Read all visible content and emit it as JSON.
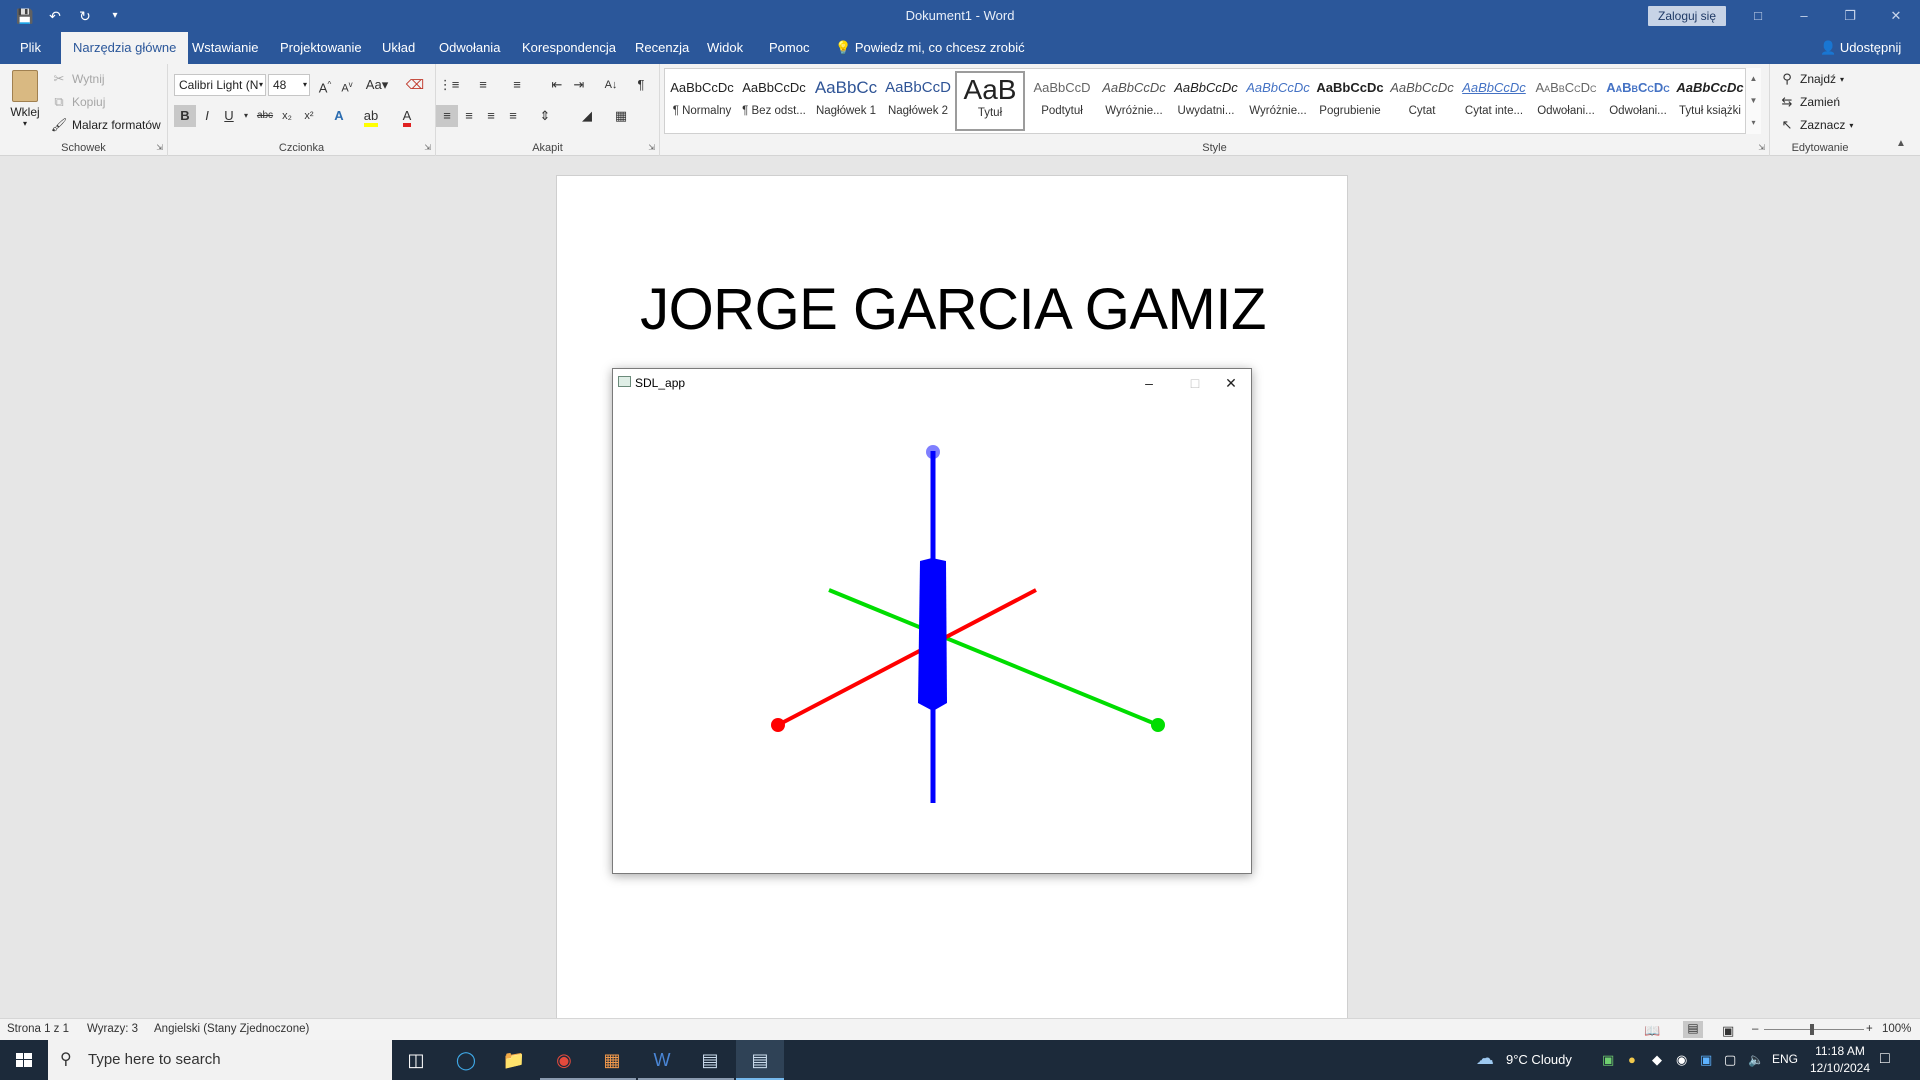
{
  "window": {
    "title": "Dokument1 - Word",
    "signin_label": "Zaloguj się",
    "qat": {
      "save_icon": "save-icon",
      "undo_icon": "undo-icon",
      "redo_icon": "redo-icon",
      "customize_icon": "customize-qat-icon"
    }
  },
  "tabs": [
    {
      "label": "Plik"
    },
    {
      "label": "Narzędzia główne",
      "active": true
    },
    {
      "label": "Wstawianie"
    },
    {
      "label": "Projektowanie"
    },
    {
      "label": "Układ"
    },
    {
      "label": "Odwołania"
    },
    {
      "label": "Korespondencja"
    },
    {
      "label": "Recenzja"
    },
    {
      "label": "Widok"
    },
    {
      "label": "Pomoc"
    }
  ],
  "tell_me": "Powiedz mi, co chcesz zrobić",
  "share_label": "Udostępnij",
  "clipboard": {
    "paste_label": "Wklej",
    "cut_label": "Wytnij",
    "copy_label": "Kopiuj",
    "format_painter_label": "Malarz formatów",
    "group_label": "Schowek"
  },
  "font": {
    "font_name": "Calibri Light (N",
    "font_size": "48",
    "case_label": "Aa",
    "bold": "B",
    "italic": "I",
    "underline": "U",
    "strike": "abc",
    "sub": "x₂",
    "sup": "x²",
    "group_label": "Czcionka"
  },
  "paragraph": {
    "group_label": "Akapit"
  },
  "styles": {
    "items": [
      {
        "sample": "AaBbCcDc",
        "name": "¶ Normalny"
      },
      {
        "sample": "AaBbCcDc",
        "name": "¶ Bez odst..."
      },
      {
        "sample": "AaBbCc",
        "name": "Nagłówek 1"
      },
      {
        "sample": "AaBbCcD",
        "name": "Nagłówek 2"
      },
      {
        "sample": "AaB",
        "name": "Tytuł"
      },
      {
        "sample": "AaBbCcD",
        "name": "Podtytuł"
      },
      {
        "sample": "AaBbCcDc",
        "name": "Wyróżnie..."
      },
      {
        "sample": "AaBbCcDc",
        "name": "Uwydatni..."
      },
      {
        "sample": "AaBbCcDc",
        "name": "Wyróżnie..."
      },
      {
        "sample": "AaBbCcDc",
        "name": "Pogrubienie"
      },
      {
        "sample": "AaBbCcDc",
        "name": "Cytat"
      },
      {
        "sample": "AaBbCcDc",
        "name": "Cytat inte..."
      },
      {
        "sample": "AaBbCcDc",
        "name": "Odwołani..."
      },
      {
        "sample": "AaBbCcDc",
        "name": "Odwołani..."
      },
      {
        "sample": "AaBbCcDc",
        "name": "Tytuł książki"
      }
    ],
    "group_label": "Style"
  },
  "editing": {
    "find_label": "Znajdź",
    "replace_label": "Zamień",
    "select_label": "Zaznacz",
    "group_label": "Edytowanie"
  },
  "document": {
    "heading": "JORGE GARCIA GAMIZ"
  },
  "sdl_window": {
    "title": "SDL_app",
    "axes": {
      "x_color": "#ff0000",
      "y_color": "#0000ff",
      "z_color": "#00dd00",
      "origin_color": "#0000ff"
    }
  },
  "status": {
    "page": "Strona 1 z 1",
    "words": "Wyrazy: 3",
    "language": "Angielski (Stany Zjednoczone)",
    "zoom": "100%"
  },
  "taskbar": {
    "search_placeholder": "Type here to search",
    "weather": "9°C  Cloudy",
    "lang": "ENG",
    "time": "11:18 AM",
    "date": "12/10/2024"
  }
}
